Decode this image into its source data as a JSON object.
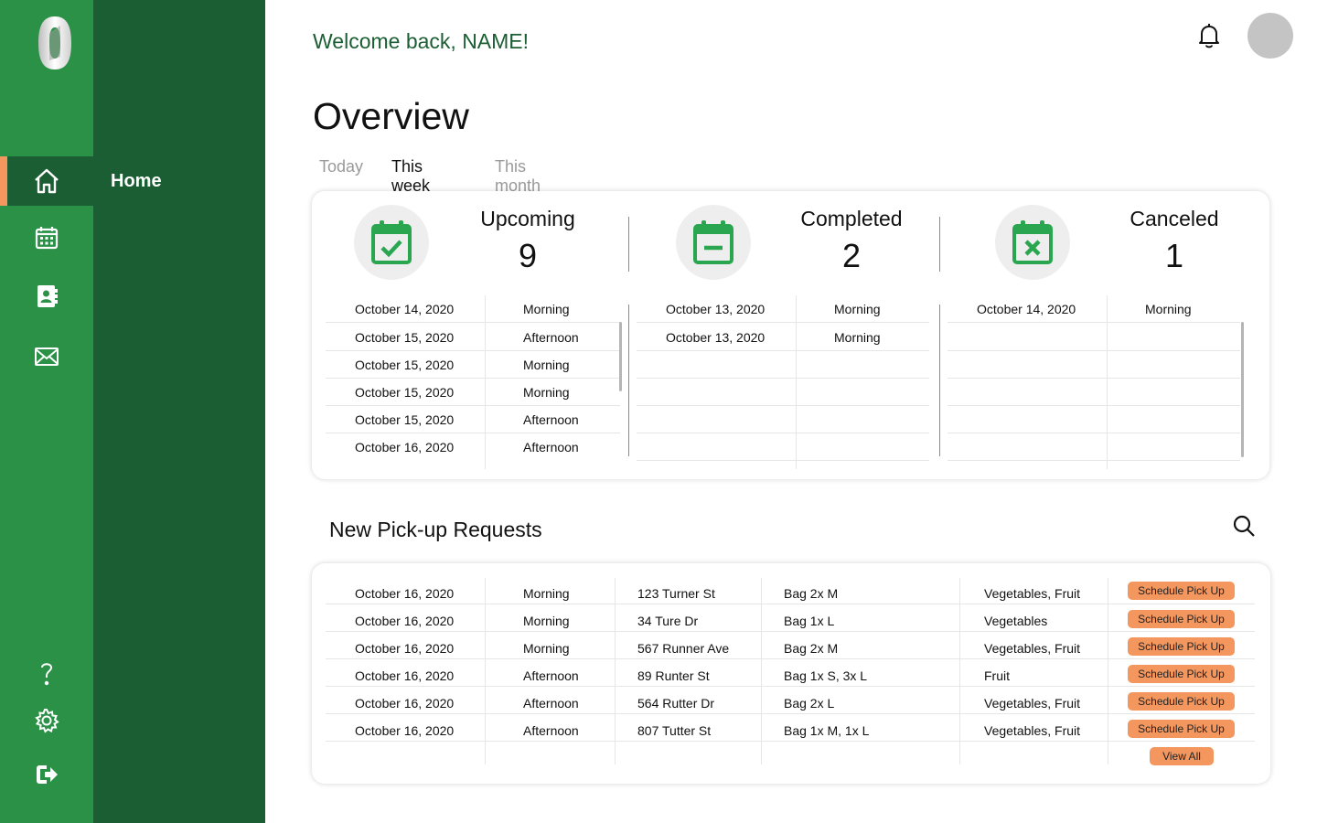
{
  "sidebar": {
    "items": [
      {
        "name": "home",
        "icon": "home-icon",
        "label": "Home",
        "active": true
      },
      {
        "name": "calendar",
        "icon": "calendar-icon",
        "label": ""
      },
      {
        "name": "contacts",
        "icon": "contact-book-icon",
        "label": ""
      },
      {
        "name": "messages",
        "icon": "envelope-icon",
        "label": ""
      }
    ],
    "bottom_items": [
      {
        "name": "help",
        "icon": "question-mark-icon"
      },
      {
        "name": "settings",
        "icon": "gear-icon"
      },
      {
        "name": "logout",
        "icon": "logout-icon"
      }
    ]
  },
  "header": {
    "welcome": "Welcome back, NAME!",
    "icons": [
      "bell-icon",
      "avatar"
    ]
  },
  "overview": {
    "title": "Overview",
    "tabs": [
      {
        "label": "Today",
        "active": false
      },
      {
        "label": "This week",
        "active": true
      },
      {
        "label": "This month",
        "active": false
      }
    ]
  },
  "stats": {
    "upcoming": {
      "label": "Upcoming",
      "value": "9",
      "icon": "calendar-check-icon",
      "rows": [
        {
          "date": "October 14, 2020",
          "time": "Morning"
        },
        {
          "date": "October 15, 2020",
          "time": "Afternoon"
        },
        {
          "date": "October 15, 2020",
          "time": "Morning"
        },
        {
          "date": "October 15, 2020",
          "time": "Morning"
        },
        {
          "date": "October 15, 2020",
          "time": "Afternoon"
        },
        {
          "date": "October 16, 2020",
          "time": "Afternoon"
        }
      ]
    },
    "completed": {
      "label": "Completed",
      "value": "2",
      "icon": "calendar-minus-icon",
      "rows": [
        {
          "date": "October 13, 2020",
          "time": "Morning"
        },
        {
          "date": "October 13, 2020",
          "time": "Morning"
        }
      ]
    },
    "canceled": {
      "label": "Canceled",
      "value": "1",
      "icon": "calendar-x-icon",
      "rows": [
        {
          "date": "October 14, 2020",
          "time": "Morning"
        }
      ]
    }
  },
  "requests": {
    "title": "New Pick-up Requests",
    "search_icon": "search-icon",
    "action_label": "Schedule Pick Up",
    "view_all_label": "View All",
    "rows": [
      {
        "date": "October 16, 2020",
        "time": "Morning",
        "address": "123 Turner St",
        "bags": "Bag 2x M",
        "items": "Vegetables, Fruit"
      },
      {
        "date": "October 16, 2020",
        "time": "Morning",
        "address": "34 Ture Dr",
        "bags": "Bag 1x L",
        "items": "Vegetables"
      },
      {
        "date": "October 16, 2020",
        "time": "Morning",
        "address": "567 Runner Ave",
        "bags": "Bag 2x M",
        "items": "Vegetables, Fruit"
      },
      {
        "date": "October 16, 2020",
        "time": "Afternoon",
        "address": "89 Runter St",
        "bags": "Bag 1x S, 3x L",
        "items": "Fruit"
      },
      {
        "date": "October 16, 2020",
        "time": "Afternoon",
        "address": "564 Rutter Dr",
        "bags": "Bag 2x L",
        "items": "Vegetables, Fruit"
      },
      {
        "date": "October 16, 2020",
        "time": "Afternoon",
        "address": "807 Tutter St",
        "bags": "Bag 1x M, 1x L",
        "items": "Vegetables, Fruit"
      }
    ]
  },
  "colors": {
    "rail": "#2a9146",
    "panel": "#1b5e33",
    "accent": "#f4975e",
    "icon_green": "#2aa651"
  }
}
